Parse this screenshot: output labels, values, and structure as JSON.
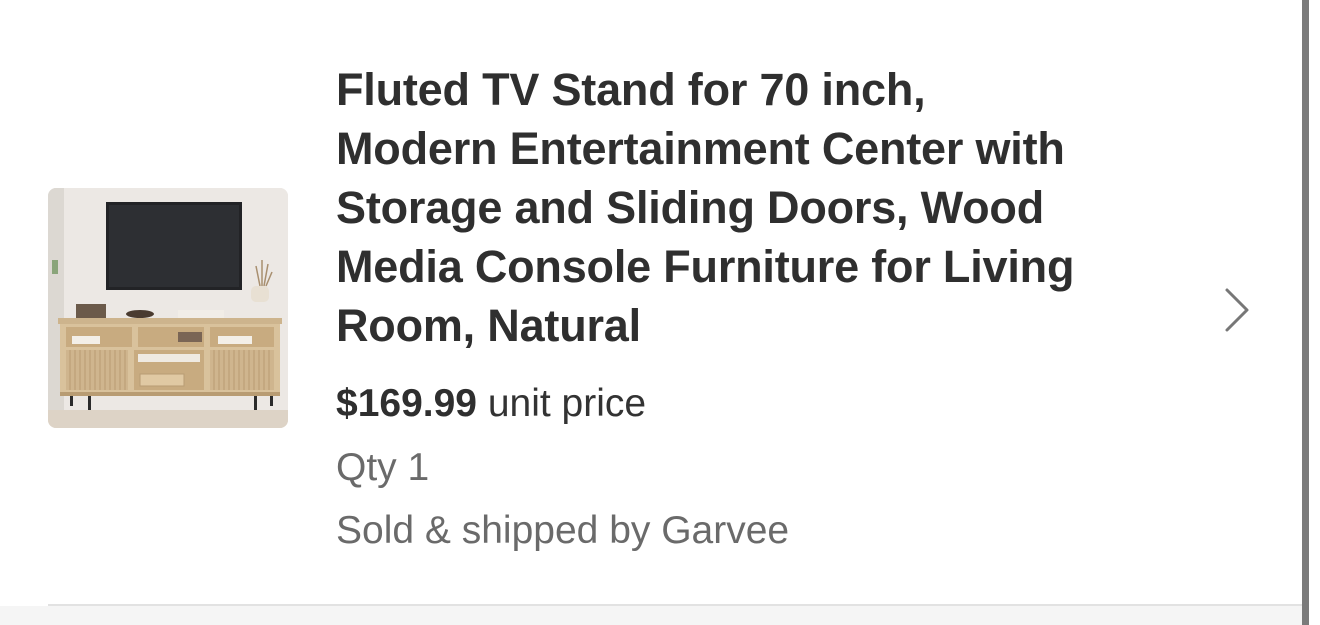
{
  "cart_item": {
    "product_image_alt": "Fluted TV stand product image",
    "title": "Fluted TV Stand for 70 inch, Modern Entertainment Center with Storage and Sliding Doors, Wood Media Console Furniture for Living Room, Natural",
    "price": "$169.99",
    "price_suffix": " unit price",
    "quantity": "Qty 1",
    "seller": "Sold & shipped by Garvee"
  },
  "icons": {
    "details": "chevron-right-icon"
  },
  "colors": {
    "title_text": "#2f2f2f",
    "secondary_text": "#6a6a6a",
    "chevron": "#777777",
    "divider": "#e2e2e2"
  }
}
